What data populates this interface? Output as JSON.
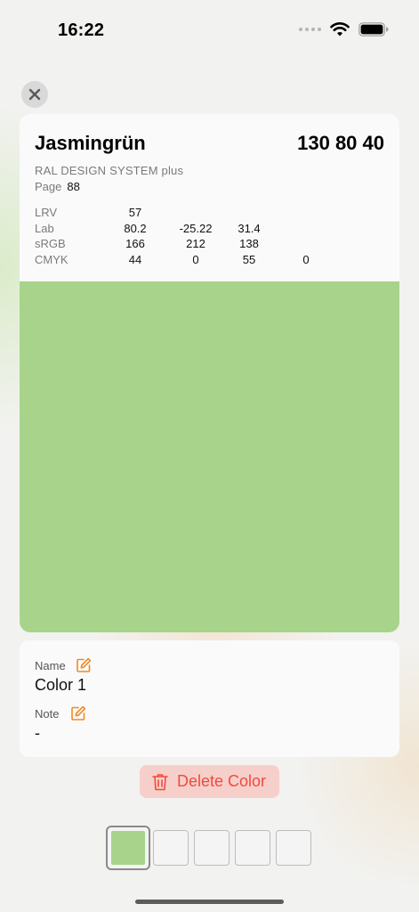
{
  "status_bar": {
    "time": "16:22"
  },
  "color": {
    "name": "Jasmingrün",
    "code": "130 80 40",
    "system": "RAL DESIGN SYSTEM plus",
    "page_label": "Page",
    "page_value": "88",
    "swatch_hex": "#a7d48a",
    "values": [
      {
        "label": "LRV",
        "values": [
          "57"
        ]
      },
      {
        "label": "Lab",
        "values": [
          "80.2",
          "-25.22",
          "31.4"
        ]
      },
      {
        "label": "sRGB",
        "values": [
          "166",
          "212",
          "138"
        ]
      },
      {
        "label": "CMYK",
        "values": [
          "44",
          "0",
          "55",
          "0"
        ]
      }
    ]
  },
  "details": {
    "name_label": "Name",
    "name_value": "Color 1",
    "note_label": "Note",
    "note_value": "-"
  },
  "actions": {
    "delete_label": "Delete Color"
  },
  "palette": {
    "slots": [
      {
        "filled": true,
        "hex": "#a7d48a",
        "selected": true
      },
      {
        "filled": false
      },
      {
        "filled": false
      },
      {
        "filled": false
      },
      {
        "filled": false
      }
    ]
  },
  "colors": {
    "accent_orange": "#f08a24",
    "delete_red": "#f04a3d",
    "delete_bg": "#f6cfcb"
  }
}
